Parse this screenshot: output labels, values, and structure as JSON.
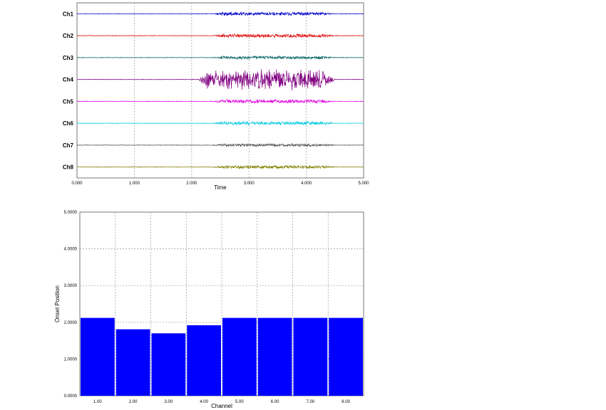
{
  "chart_data": [
    {
      "type": "line",
      "xlabel": "Time",
      "ylabel": "",
      "xlim": [
        0,
        5
      ],
      "x_ticks": [
        "0.000",
        "1.000",
        "2.000",
        "3.000",
        "4.000",
        "5.000"
      ],
      "grid": true,
      "series": [
        {
          "name": "Ch1",
          "color": "#0000cc",
          "onset": 2.35,
          "offset": 4.5,
          "amplitude_level": 0.18
        },
        {
          "name": "Ch2",
          "color": "#e00000",
          "onset": 2.35,
          "offset": 4.5,
          "amplitude_level": 0.18
        },
        {
          "name": "Ch3",
          "color": "#006060",
          "onset": 2.35,
          "offset": 4.5,
          "amplitude_level": 0.15
        },
        {
          "name": "Ch4",
          "color": "#800080",
          "onset": 2.1,
          "offset": 4.5,
          "amplitude_level": 1.0
        },
        {
          "name": "Ch5",
          "color": "#e000e0",
          "onset": 2.35,
          "offset": 4.5,
          "amplitude_level": 0.18
        },
        {
          "name": "Ch6",
          "color": "#00c8e0",
          "onset": 2.35,
          "offset": 4.5,
          "amplitude_level": 0.18
        },
        {
          "name": "Ch7",
          "color": "#505050",
          "onset": 2.35,
          "offset": 4.5,
          "amplitude_level": 0.15
        },
        {
          "name": "Ch8",
          "color": "#808000",
          "onset": 2.35,
          "offset": 4.5,
          "amplitude_level": 0.15
        }
      ]
    },
    {
      "type": "bar",
      "xlabel": "Channel",
      "ylabel": "Onset Position",
      "categories": [
        "1.00",
        "2.00",
        "3.00",
        "4.00",
        "5.00",
        "6.00",
        "7.00",
        "8.00"
      ],
      "values": [
        2.12,
        1.81,
        1.7,
        1.92,
        2.12,
        2.12,
        2.12,
        2.12
      ],
      "ylim": [
        0,
        5
      ],
      "y_ticks": [
        "0.0000",
        "1.0000",
        "2.0000",
        "3.0000",
        "4.0000",
        "5.0000"
      ],
      "bar_color": "#0000ff",
      "grid": true
    }
  ]
}
